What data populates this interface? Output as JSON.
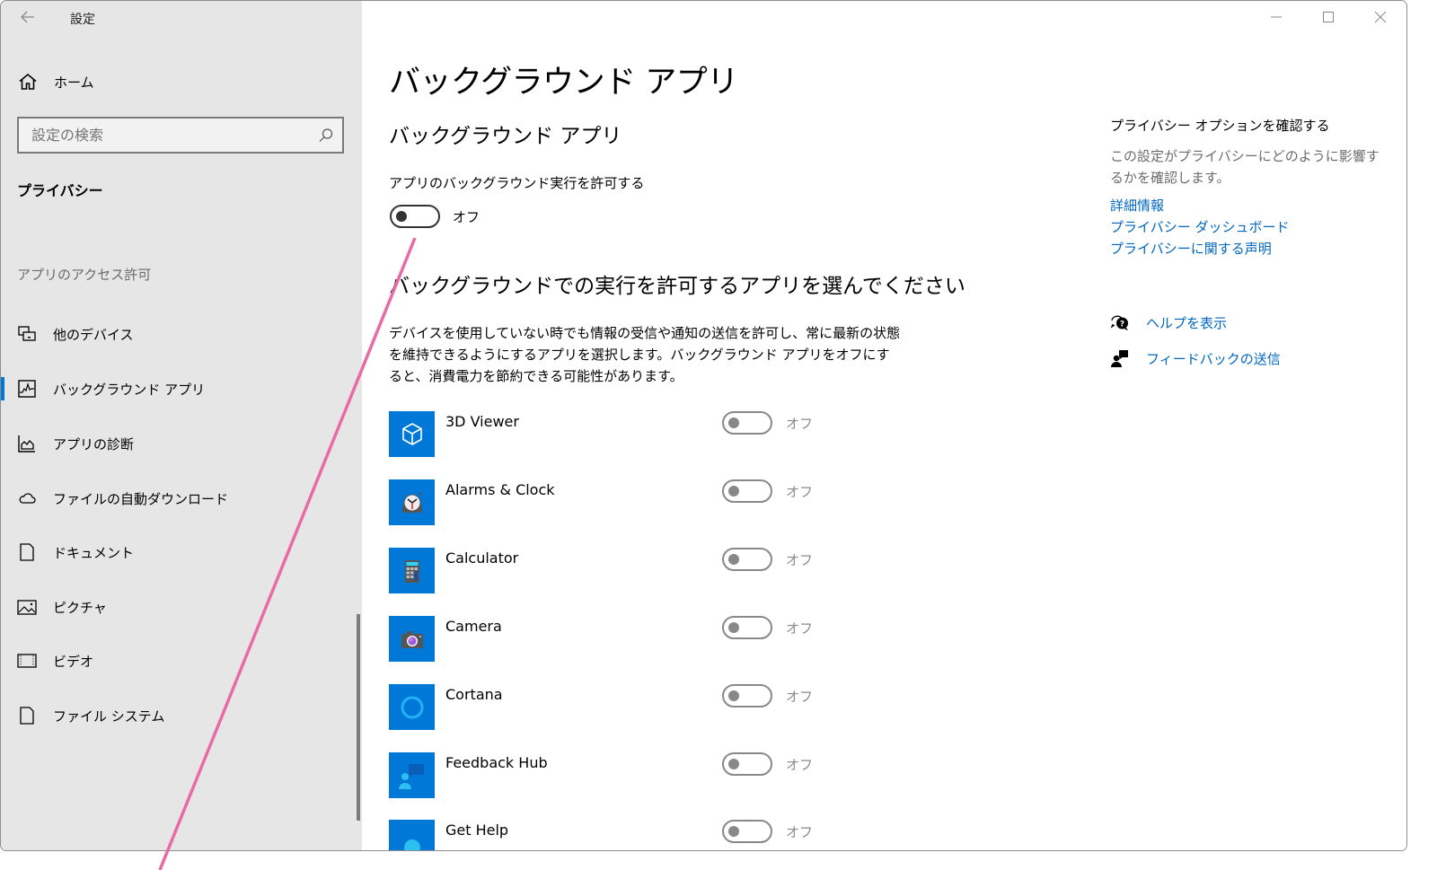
{
  "window": {
    "title": "設定",
    "back_icon": "back-arrow-icon",
    "controls": {
      "minimize_icon": "minimize-icon",
      "maximize_icon": "maximize-icon",
      "close_icon": "close-icon"
    }
  },
  "sidebar": {
    "home": {
      "label": "ホーム",
      "icon": "home-icon"
    },
    "search": {
      "placeholder": "設定の検索",
      "value": "",
      "icon": "search-icon"
    },
    "section_title": "プライバシー",
    "group_title": "アプリのアクセス許可",
    "items": [
      {
        "label": "他のデバイス",
        "icon": "other-devices-icon",
        "active": false
      },
      {
        "label": "バックグラウンド アプリ",
        "icon": "background-apps-icon",
        "active": true
      },
      {
        "label": "アプリの診断",
        "icon": "app-diagnostics-icon",
        "active": false
      },
      {
        "label": "ファイルの自動ダウンロード",
        "icon": "cloud-icon",
        "active": false
      },
      {
        "label": "ドキュメント",
        "icon": "document-icon",
        "active": false
      },
      {
        "label": "ピクチャ",
        "icon": "picture-icon",
        "active": false
      },
      {
        "label": "ビデオ",
        "icon": "video-icon",
        "active": false
      },
      {
        "label": "ファイル システム",
        "icon": "file-system-icon",
        "active": false
      }
    ]
  },
  "main": {
    "page_title": "バックグラウンド アプリ",
    "sub_title": "バックグラウンド アプリ",
    "master_toggle": {
      "label": "アプリのバックグラウンド実行を許可する",
      "state": "オフ",
      "on": false
    },
    "list_heading": "バックグラウンドでの実行を許可するアプリを選んでください",
    "description": "デバイスを使用していない時でも情報の受信や通知の送信を許可し、常に最新の状態を維持できるようにするアプリを選択します。バックグラウンド アプリをオフにすると、消費電力を節約できる可能性があります。",
    "apps": [
      {
        "name": "3D Viewer",
        "icon": "3d-viewer-icon",
        "state": "オフ",
        "on": false,
        "enabled": false
      },
      {
        "name": "Alarms & Clock",
        "icon": "alarms-clock-icon",
        "state": "オフ",
        "on": false,
        "enabled": false
      },
      {
        "name": "Calculator",
        "icon": "calculator-icon",
        "state": "オフ",
        "on": false,
        "enabled": false
      },
      {
        "name": "Camera",
        "icon": "camera-icon",
        "state": "オフ",
        "on": false,
        "enabled": false
      },
      {
        "name": "Cortana",
        "icon": "cortana-icon",
        "state": "オフ",
        "on": false,
        "enabled": false
      },
      {
        "name": "Feedback Hub",
        "icon": "feedback-hub-icon",
        "state": "オフ",
        "on": false,
        "enabled": false
      },
      {
        "name": "Get Help",
        "icon": "get-help-icon",
        "state": "オフ",
        "on": false,
        "enabled": false
      }
    ]
  },
  "right_panel": {
    "title": "プライバシー オプションを確認する",
    "description": "この設定がプライバシーにどのように影響するかを確認します。",
    "links": [
      {
        "label": "詳細情報"
      },
      {
        "label": "プライバシー ダッシュボード"
      },
      {
        "label": "プライバシーに関する声明"
      }
    ],
    "actions": [
      {
        "label": "ヘルプを表示",
        "icon": "help-chat-icon"
      },
      {
        "label": "フィードバックの送信",
        "icon": "feedback-icon"
      }
    ]
  },
  "colors": {
    "accent": "#0078d7",
    "link": "#0067c0",
    "sidebar_bg": "#e6e6e6",
    "annotation": "#e86aa6"
  }
}
